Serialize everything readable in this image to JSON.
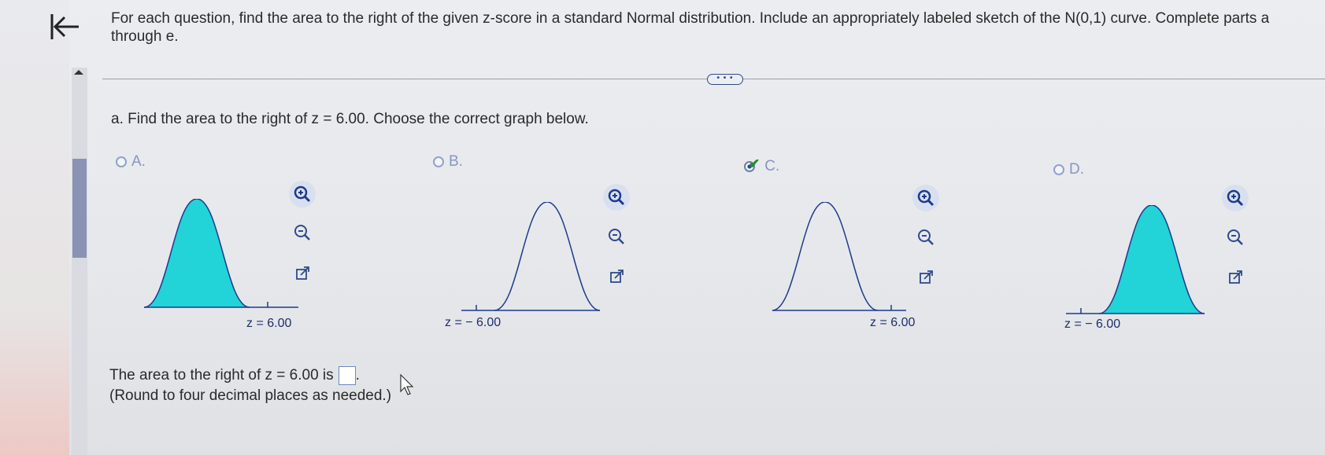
{
  "question": {
    "text": "For each question, find the area to the right of the given z-score in a standard Normal distribution. Include an appropriately labeled sketch of the N(0,1) curve. Complete parts a through e."
  },
  "more_button": {
    "label": "• • •"
  },
  "part_a": {
    "prompt": "a. Find the area to the right of z = 6.00. Choose the correct graph below."
  },
  "options": [
    {
      "letter": "A.",
      "z_label": "z = 6.00",
      "selected": false,
      "shaded": "left"
    },
    {
      "letter": "B.",
      "z_label": "z = − 6.00",
      "selected": false,
      "shaded": "none"
    },
    {
      "letter": "C.",
      "z_label": "z = 6.00",
      "selected": true,
      "shaded": "none"
    },
    {
      "letter": "D.",
      "z_label": "z = − 6.00",
      "selected": false,
      "shaded": "right"
    }
  ],
  "answer": {
    "prefix": "The area to the right of z = 6.00 is",
    "suffix": ".",
    "value": "",
    "note": "(Round to four decimal places as needed.)"
  },
  "colors": {
    "shade": "#22d3d8",
    "curve": "#1e3a8a",
    "accent": "#2f4a8a"
  },
  "icons": [
    "back-arrow-icon",
    "zoom-in-icon",
    "zoom-out-icon",
    "external-link-icon",
    "checkmark-icon",
    "pointer-cursor-icon"
  ]
}
